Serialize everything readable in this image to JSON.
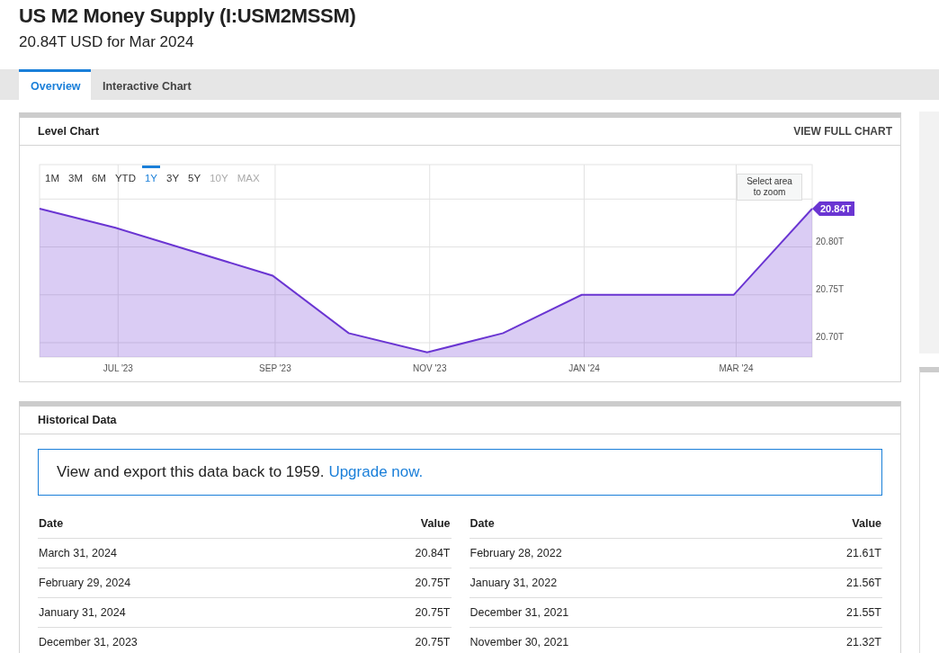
{
  "header": {
    "title": "US M2 Money Supply (I:USM2MSSM)",
    "subtitle": "20.84T USD for Mar 2024"
  },
  "tabs": [
    {
      "label": "Overview",
      "selected": true
    },
    {
      "label": "Interactive Chart",
      "selected": false
    }
  ],
  "level_chart": {
    "title": "Level Chart",
    "link": "VIEW FULL CHART",
    "ranges": [
      {
        "label": "1M",
        "selected": false,
        "disabled": false
      },
      {
        "label": "3M",
        "selected": false,
        "disabled": false
      },
      {
        "label": "6M",
        "selected": false,
        "disabled": false
      },
      {
        "label": "YTD",
        "selected": false,
        "disabled": false
      },
      {
        "label": "1Y",
        "selected": true,
        "disabled": false
      },
      {
        "label": "3Y",
        "selected": false,
        "disabled": false
      },
      {
        "label": "5Y",
        "selected": false,
        "disabled": false
      },
      {
        "label": "10Y",
        "selected": false,
        "disabled": true
      },
      {
        "label": "MAX",
        "selected": false,
        "disabled": true
      }
    ],
    "zoom_hint": "Select area to zoom",
    "last_value_label": "20.84T",
    "chart_data": {
      "type": "area",
      "x": [
        "2023-05-31",
        "2023-06-30",
        "2023-08-31",
        "2023-09-30",
        "2023-10-31",
        "2023-11-30",
        "2023-12-31",
        "2024-01-31",
        "2024-02-29",
        "2024-03-31"
      ],
      "series": [
        {
          "color": "#6a35d2",
          "values": [
            20.84,
            20.82,
            20.77,
            20.71,
            20.69,
            20.71,
            20.75,
            20.75,
            20.75,
            20.84
          ]
        }
      ],
      "xlim": [
        "2023-05-31",
        "2024-03-31"
      ],
      "ylim": [
        20.685,
        20.886
      ],
      "grid": true,
      "xticks": [
        {
          "value": "2023-07-01",
          "label": "JUL '23"
        },
        {
          "value": "2023-09-01",
          "label": "SEP '23"
        },
        {
          "value": "2023-11-01",
          "label": "NOV '23"
        },
        {
          "value": "2024-01-01",
          "label": "JAN '24"
        },
        {
          "value": "2024-03-01",
          "label": "MAR '24"
        }
      ],
      "yticks": [
        {
          "value": 20.7,
          "label": "20.70T"
        },
        {
          "value": 20.75,
          "label": "20.75T"
        },
        {
          "value": 20.8,
          "label": "20.80T"
        }
      ]
    }
  },
  "historical_data": {
    "title": "Historical Data",
    "banner": "View and export this data back to 1959.",
    "banner_link": "Upgrade now.",
    "tables": [
      {
        "columns": [
          "Date",
          "Value"
        ],
        "rows": [
          [
            "March 31, 2024",
            "20.84T"
          ],
          [
            "February 29, 2024",
            "20.75T"
          ],
          [
            "January 31, 2024",
            "20.75T"
          ],
          [
            "December 31, 2023",
            "20.75T"
          ]
        ]
      },
      {
        "columns": [
          "Date",
          "Value"
        ],
        "rows": [
          [
            "February 28, 2022",
            "21.61T"
          ],
          [
            "January 31, 2022",
            "21.56T"
          ],
          [
            "December 31, 2021",
            "21.55T"
          ],
          [
            "November 30, 2021",
            "21.32T"
          ]
        ]
      }
    ]
  }
}
